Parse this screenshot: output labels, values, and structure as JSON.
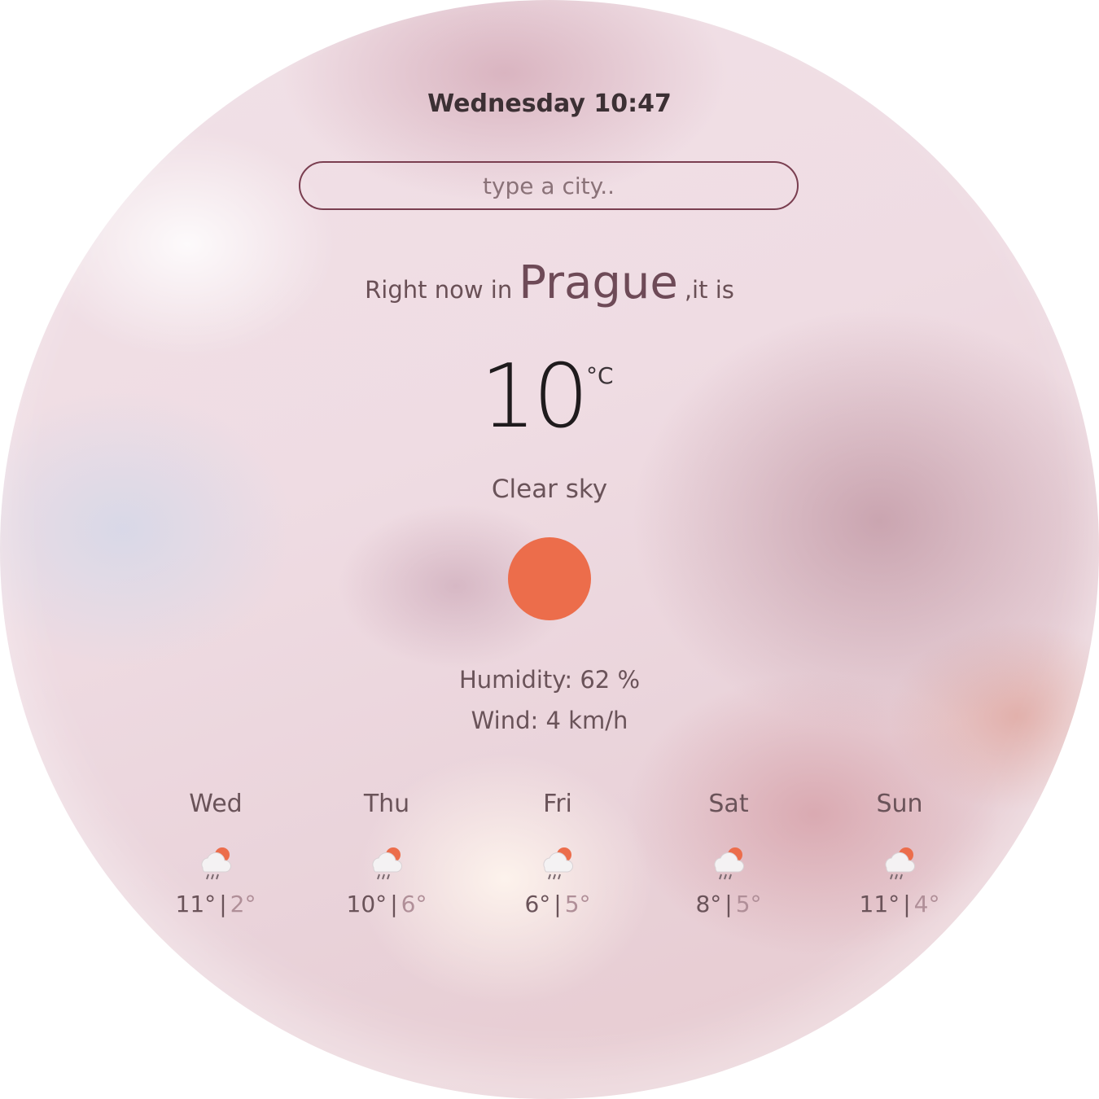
{
  "header": {
    "datetime": "Wednesday 10:47"
  },
  "search": {
    "placeholder": "type a city.."
  },
  "current": {
    "prefix": "Right now in",
    "city": "Prague",
    "suffix": ",it is",
    "temperature": "10",
    "unit": "°C",
    "description": "Clear sky",
    "icon": "sun-icon",
    "humidity": "Humidity: 62 %",
    "wind": "Wind: 4 km/h"
  },
  "colors": {
    "sun": "#ec6d4b",
    "search_border": "#7a3e50"
  },
  "forecast": [
    {
      "day": "Wed",
      "icon": "rain-cloud-sun-icon",
      "high": "11°",
      "low": "2°"
    },
    {
      "day": "Thu",
      "icon": "rain-cloud-sun-icon",
      "high": "10°",
      "low": "6°"
    },
    {
      "day": "Fri",
      "icon": "rain-cloud-sun-icon",
      "high": "6°",
      "low": "5°"
    },
    {
      "day": "Sat",
      "icon": "rain-cloud-sun-icon",
      "high": "8°",
      "low": "5°"
    },
    {
      "day": "Sun",
      "icon": "rain-cloud-sun-icon",
      "high": "11°",
      "low": "4°"
    }
  ],
  "separator": "|"
}
